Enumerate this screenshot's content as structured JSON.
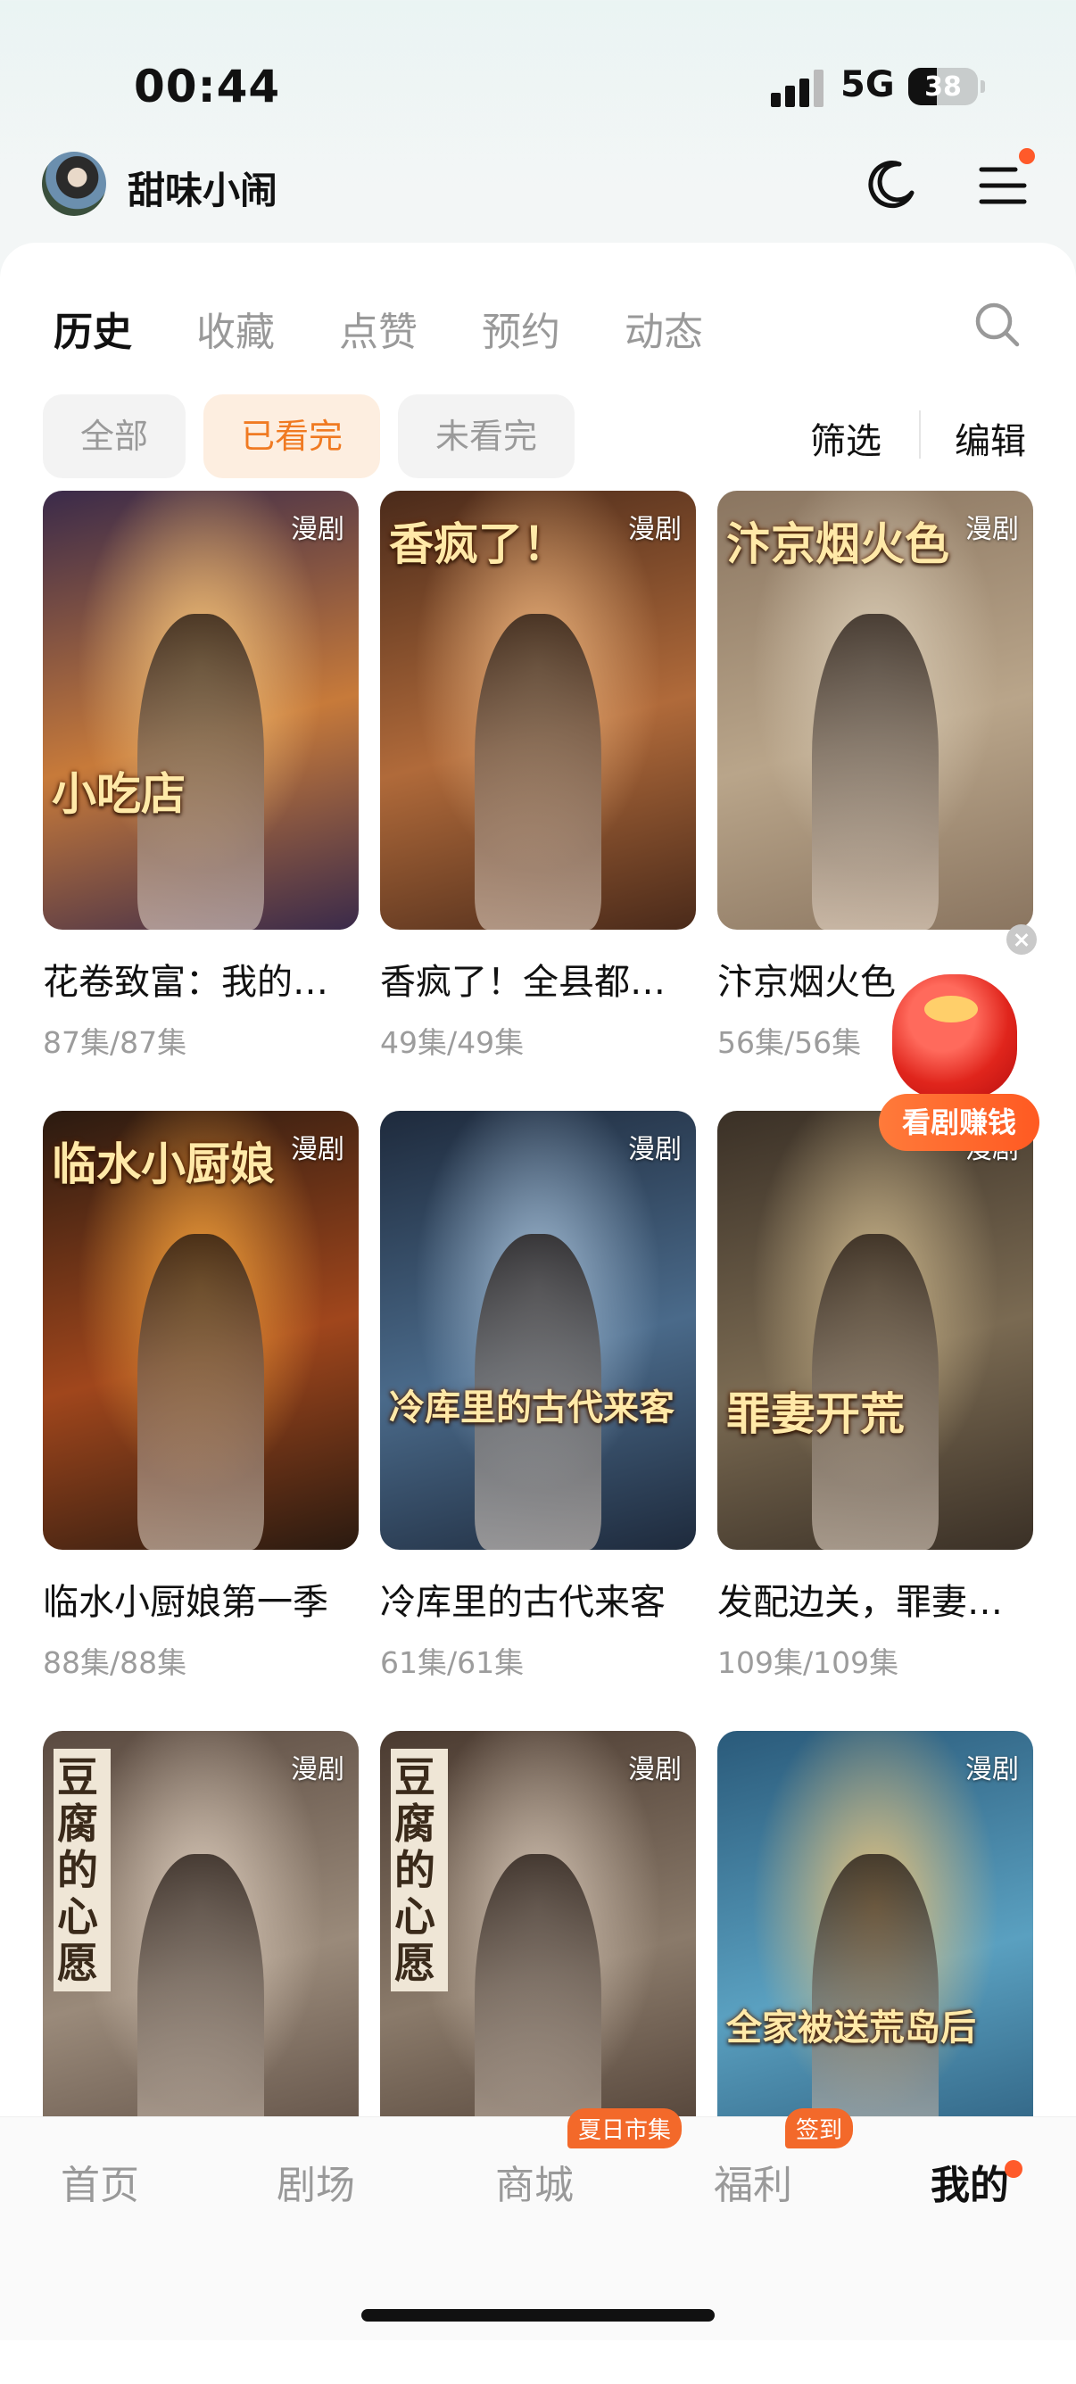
{
  "status_bar": {
    "time": "00:44",
    "network": "5G",
    "battery": "38"
  },
  "header": {
    "username": "甜味小闹"
  },
  "tabs": [
    {
      "label": "历史",
      "active": true
    },
    {
      "label": "收藏",
      "active": false
    },
    {
      "label": "点赞",
      "active": false
    },
    {
      "label": "预约",
      "active": false
    },
    {
      "label": "动态",
      "active": false
    }
  ],
  "filters": {
    "chips": [
      {
        "label": "全部",
        "active": false
      },
      {
        "label": "已看完",
        "active": true
      },
      {
        "label": "未看完",
        "active": false
      }
    ],
    "filter_label": "筛选",
    "edit_label": "编辑"
  },
  "items": [
    {
      "tag": "漫剧",
      "title": "花卷致富：我的…",
      "episodes": "87集/87集",
      "poster_text": "小吃店",
      "colors": [
        "#3a2a4a",
        "#c77a3a",
        "#f3c27a"
      ]
    },
    {
      "tag": "漫剧",
      "title": "香疯了！全县都…",
      "episodes": "49集/49集",
      "poster_text": "香疯了！",
      "colors": [
        "#4a2a1a",
        "#b06a3a",
        "#e8b07a"
      ]
    },
    {
      "tag": "漫剧",
      "title": "汴京烟火色",
      "episodes": "56集/56集",
      "poster_text": "汴京烟火色",
      "colors": [
        "#8a7560",
        "#b9a58a",
        "#d9cbb4"
      ]
    },
    {
      "tag": "漫剧",
      "title": "临水小厨娘第一季",
      "episodes": "88集/88集",
      "poster_text": "临水小厨娘",
      "colors": [
        "#2a1a10",
        "#a0461c",
        "#f2a03a"
      ]
    },
    {
      "tag": "漫剧",
      "title": "冷库里的古代来客",
      "episodes": "61集/61集",
      "poster_text": "冷库里的古代来客",
      "colors": [
        "#1e2a3c",
        "#4a6a8a",
        "#9fb8d0"
      ]
    },
    {
      "tag": "漫剧",
      "title": "发配边关，罪妻…",
      "episodes": "109集/109集",
      "poster_text": "罪妻开荒",
      "colors": [
        "#3a3026",
        "#7a6a52",
        "#c9b48a"
      ]
    },
    {
      "tag": "漫剧",
      "title": "",
      "episodes": "",
      "poster_text": "豆腐的心愿",
      "colors": [
        "#5a4a40",
        "#9a8a7a",
        "#d8c8b8"
      ]
    },
    {
      "tag": "漫剧",
      "title": "",
      "episodes": "",
      "poster_text": "豆腐的心愿",
      "colors": [
        "#4a3a30",
        "#8a7a6a",
        "#d0c0b0"
      ]
    },
    {
      "tag": "漫剧",
      "title": "",
      "episodes": "",
      "poster_text": "全家被送荒岛后",
      "colors": [
        "#2a5a7a",
        "#5aa0c0",
        "#e8c27a"
      ]
    }
  ],
  "promo": {
    "label": "看剧赚钱"
  },
  "bottom_nav": [
    {
      "label": "首页",
      "active": false,
      "badge": ""
    },
    {
      "label": "剧场",
      "active": false,
      "badge": ""
    },
    {
      "label": "商城",
      "active": false,
      "badge": "夏日市集"
    },
    {
      "label": "福利",
      "active": false,
      "badge": "签到"
    },
    {
      "label": "我的",
      "active": true,
      "badge": ""
    }
  ]
}
